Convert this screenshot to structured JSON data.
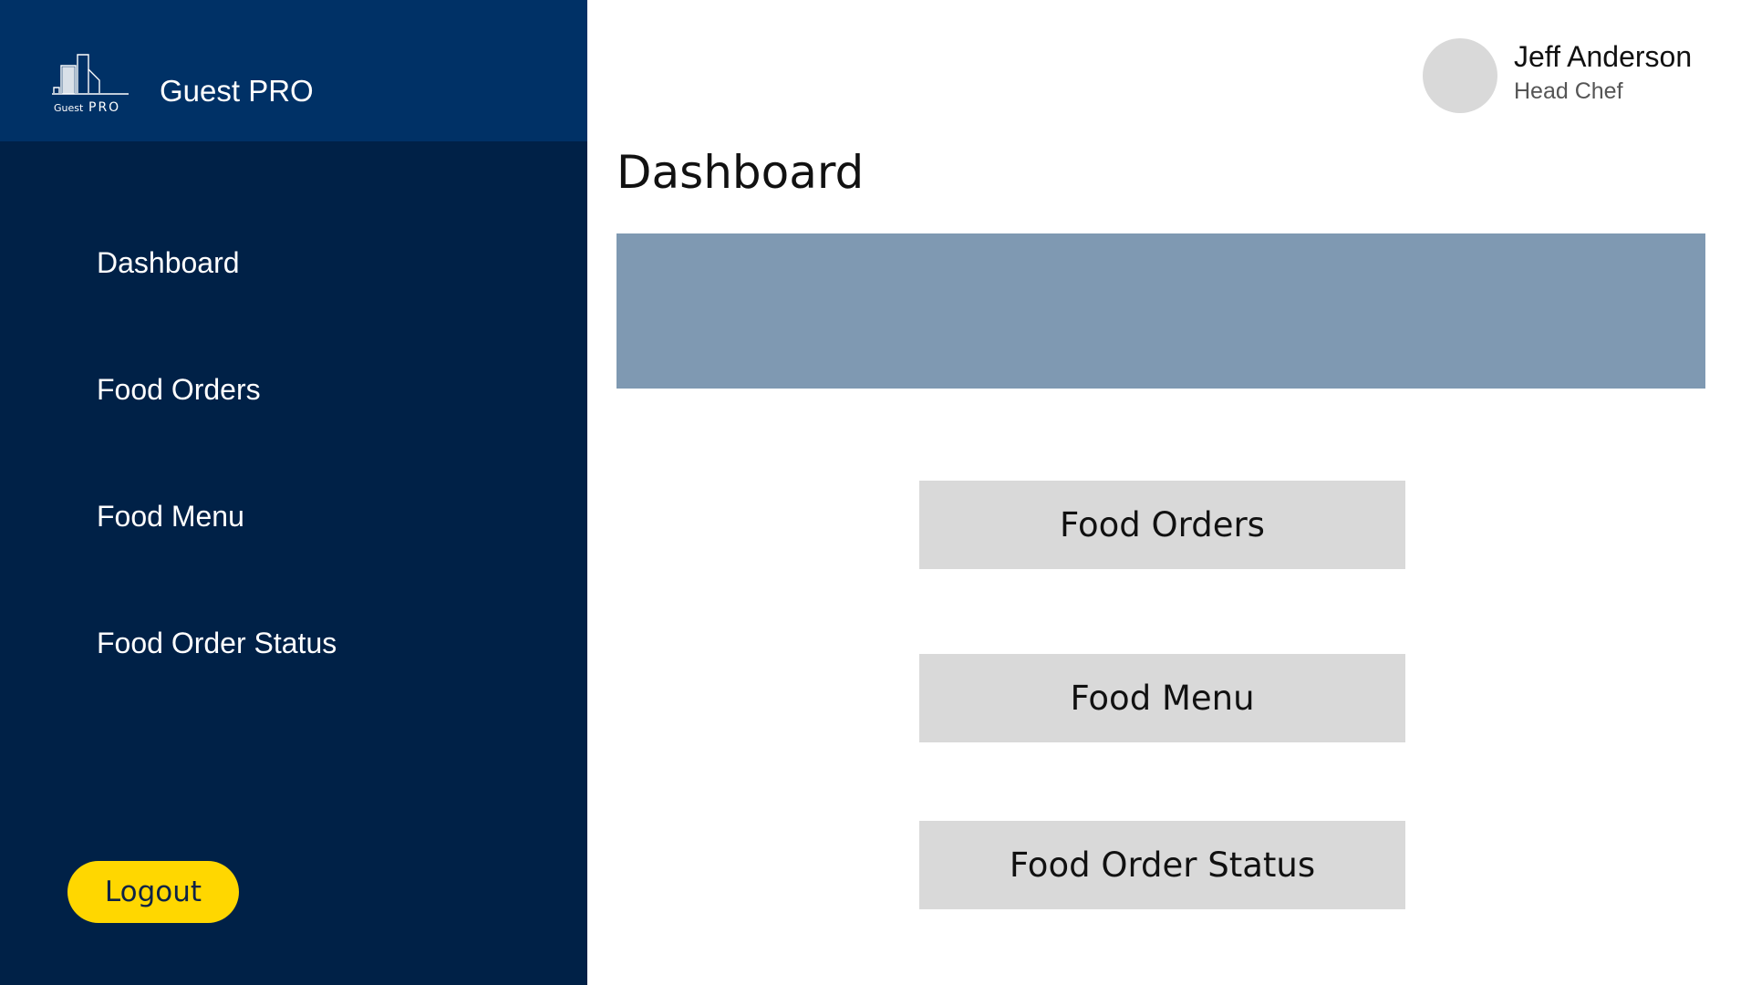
{
  "brand": {
    "logo_text_small": "Guest",
    "logo_text_large": "PRO",
    "title": "Guest PRO"
  },
  "sidebar": {
    "items": [
      {
        "label": "Dashboard"
      },
      {
        "label": "Food Orders"
      },
      {
        "label": "Food Menu"
      },
      {
        "label": "Food Order Status"
      }
    ],
    "logout_label": "Logout"
  },
  "user": {
    "name": "Jeff Anderson",
    "role": "Head Chef"
  },
  "main": {
    "title": "Dashboard",
    "tiles": [
      {
        "label": "Food Orders"
      },
      {
        "label": "Food Menu"
      },
      {
        "label": "Food Order Status"
      }
    ]
  },
  "colors": {
    "sidebar": "#002147",
    "brand_bar": "#003166",
    "logout": "#ffd700",
    "banner": "#7f99b2",
    "tile": "#d9d9d9",
    "avatar": "#d9d9d9"
  },
  "icons": {
    "logo": "building-logo-icon"
  }
}
